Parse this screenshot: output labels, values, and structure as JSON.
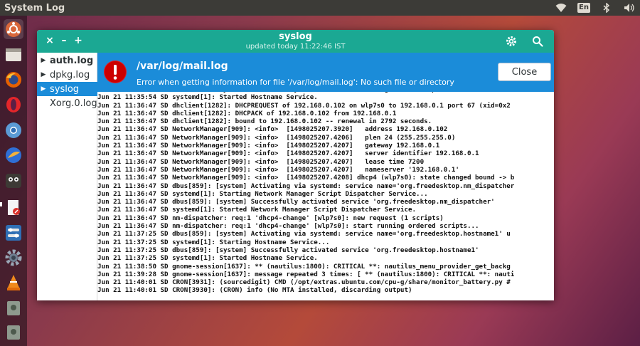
{
  "topbar": {
    "app_name": "System Log",
    "lang": "En"
  },
  "window": {
    "title": "syslog",
    "subtitle": "updated today 11:22:46  IST",
    "wm_close": "×",
    "wm_minimize": "–",
    "wm_maximize": "+"
  },
  "sidebar": {
    "items": [
      {
        "label": "auth.log",
        "expandable": true
      },
      {
        "label": "dpkg.log",
        "expandable": true
      },
      {
        "label": "syslog",
        "expandable": true
      },
      {
        "label": "Xorg.0.log",
        "expandable": false
      }
    ]
  },
  "error": {
    "title": "/var/log/mail.log",
    "message": "Error when getting information for file '/var/log/mail.log': No such file or directory",
    "close_label": "Close"
  },
  "log": {
    "lines": [
      "Jun 21 11:35:54 SD dbus[859]: [system] Successfully activated service 'org.freedesktop.hostname1'",
      "Jun 21 11:35:54 SD systemd[1]: Started Hostname Service.",
      "Jun 21 11:36:47 SD dhclient[1282]: DHCPREQUEST of 192.168.0.102 on wlp7s0 to 192.168.0.1 port 67 (xid=0x2",
      "Jun 21 11:36:47 SD dhclient[1282]: DHCPACK of 192.168.0.102 from 192.168.0.1",
      "Jun 21 11:36:47 SD dhclient[1282]: bound to 192.168.0.102 -- renewal in 2792 seconds.",
      "Jun 21 11:36:47 SD NetworkManager[909]: <info>  [1498025207.3920]   address 192.168.0.102",
      "Jun 21 11:36:47 SD NetworkManager[909]: <info>  [1498025207.4206]   plen 24 (255.255.255.0)",
      "Jun 21 11:36:47 SD NetworkManager[909]: <info>  [1498025207.4207]   gateway 192.168.0.1",
      "Jun 21 11:36:47 SD NetworkManager[909]: <info>  [1498025207.4207]   server identifier 192.168.0.1",
      "Jun 21 11:36:47 SD NetworkManager[909]: <info>  [1498025207.4207]   lease time 7200",
      "Jun 21 11:36:47 SD NetworkManager[909]: <info>  [1498025207.4207]   nameserver '192.168.0.1'",
      "Jun 21 11:36:47 SD NetworkManager[909]: <info>  [1498025207.4208] dhcp4 (wlp7s0): state changed bound -> b",
      "Jun 21 11:36:47 SD dbus[859]: [system] Activating via systemd: service name='org.freedesktop.nm_dispatcher",
      "Jun 21 11:36:47 SD systemd[1]: Starting Network Manager Script Dispatcher Service...",
      "Jun 21 11:36:47 SD dbus[859]: [system] Successfully activated service 'org.freedesktop.nm_dispatcher'",
      "Jun 21 11:36:47 SD systemd[1]: Started Network Manager Script Dispatcher Service.",
      "Jun 21 11:36:47 SD nm-dispatcher: req:1 'dhcp4-change' [wlp7s0]: new request (1 scripts)",
      "Jun 21 11:36:47 SD nm-dispatcher: req:1 'dhcp4-change' [wlp7s0]: start running ordered scripts...",
      "Jun 21 11:37:25 SD dbus[859]: [system] Activating via systemd: service name='org.freedesktop.hostname1' u",
      "Jun 21 11:37:25 SD systemd[1]: Starting Hostname Service...",
      "Jun 21 11:37:25 SD dbus[859]: [system] Successfully activated service 'org.freedesktop.hostname1'",
      "Jun 21 11:37:25 SD systemd[1]: Started Hostname Service.",
      "Jun 21 11:38:50 SD gnome-session[1637]: ** (nautilus:1800): CRITICAL **: nautilus_menu_provider_get_backg",
      "Jun 21 11:39:28 SD gnome-session[1637]: message repeated 3 times: [ ** (nautilus:1800): CRITICAL **: nauti",
      "Jun 21 11:40:01 SD CRON[3931]: (sourcedigit) CMD (/opt/extras.ubuntu.com/cpu-g/share/monitor_battery.py #",
      "Jun 21 11:40:01 SD CRON[3930]: (CRON) info (No MTA installed, discarding output)"
    ]
  }
}
